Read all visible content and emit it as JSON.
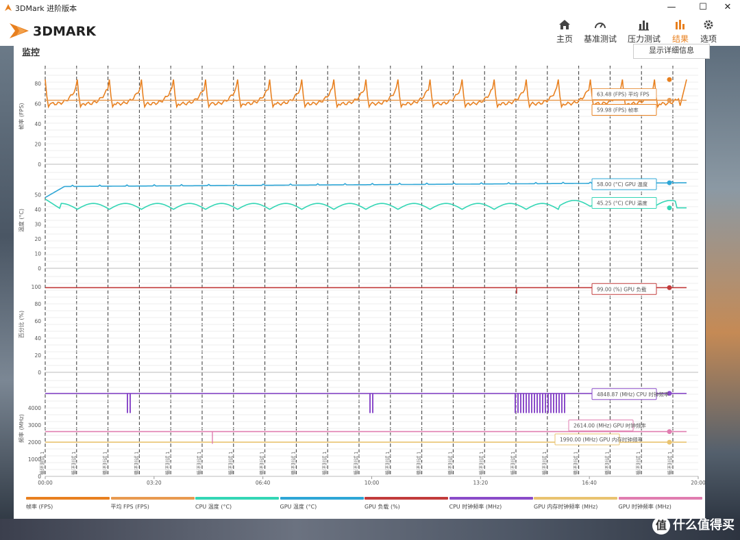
{
  "window": {
    "title": "3DMark 进阶版本",
    "minimize": "—",
    "maximize": "☐",
    "close": "✕"
  },
  "brand": {
    "logo_text": "3DMARK",
    "accent": "#e8801f"
  },
  "nav": {
    "items": [
      {
        "label": "主页",
        "icon": "home-icon"
      },
      {
        "label": "基准测试",
        "icon": "gauge-icon"
      },
      {
        "label": "压力测试",
        "icon": "bar-chart-icon"
      },
      {
        "label": "结果",
        "icon": "results-icon",
        "active": true
      },
      {
        "label": "选项",
        "icon": "gear-icon"
      }
    ]
  },
  "panel": {
    "title": "监控",
    "detail_button": "显示详细信息"
  },
  "chart_data": {
    "type": "line",
    "x_ticks": [
      "00:00",
      "03:20",
      "06:40",
      "10:00",
      "13:20",
      "16:40",
      "20:00"
    ],
    "x_range_seconds": [
      0,
      1200
    ],
    "test_marker_label": "循环测试 1",
    "subplots": [
      {
        "ylabel": "帧率 (FPS)",
        "yticks": [
          0,
          20,
          40,
          60,
          80
        ],
        "ylim": [
          0,
          95
        ],
        "series": [
          {
            "name": "帧率 (FPS)",
            "color": "#e8801f",
            "pattern": "sawtooth",
            "base": 58,
            "peak": 84,
            "end": 84
          },
          {
            "name": "平均 FPS (FPS)",
            "color": "#e89a50",
            "constant": 63.48
          }
        ],
        "callouts": [
          {
            "text": "63.48 (FPS) 平均 FPS",
            "color": "#e89a50"
          },
          {
            "text": "59.98 (FPS) 帧率",
            "color": "#e8801f"
          }
        ]
      },
      {
        "ylabel": "温度 (°C)",
        "yticks": [
          0,
          10,
          20,
          30,
          40,
          50
        ],
        "ylim": [
          0,
          65
        ],
        "series": [
          {
            "name": "GPU 温度 (°C)",
            "color": "#2ea6d6",
            "start": 48,
            "plateau": 55.5,
            "end": 58
          },
          {
            "name": "CPU 温度 (°C)",
            "color": "#33d6b5",
            "start": 47,
            "base": 40,
            "peak": 44,
            "end": 41
          }
        ],
        "callouts": [
          {
            "text": "58.00 (°C) GPU 温度",
            "color": "#2ea6d6"
          },
          {
            "text": "45.25 (°C) CPU 温度",
            "color": "#33d6b5"
          }
        ]
      },
      {
        "ylabel": "百分比 (%)",
        "yticks": [
          0,
          20,
          40,
          60,
          80,
          100
        ],
        "ylim": [
          0,
          112
        ],
        "series": [
          {
            "name": "GPU 负载 (%)",
            "color": "#c23b3b",
            "constant": 99
          }
        ],
        "callouts": [
          {
            "text": "99.00 (%) GPU 负载",
            "color": "#c23b3b"
          }
        ]
      },
      {
        "ylabel": "频率 (MHz)",
        "yticks": [
          0,
          1000,
          2000,
          3000,
          4000
        ],
        "ylim": [
          0,
          5600
        ],
        "series": [
          {
            "name": "CPU 时钟频率 (MHz)",
            "color": "#8a4bc9",
            "constant": 4848.87
          },
          {
            "name": "GPU 时钟频率 (MHz)",
            "color": "#e07db0",
            "constant": 2614
          },
          {
            "name": "GPU 内存时钟频率 (MHz)",
            "color": "#e9c370",
            "constant": 1995
          }
        ],
        "callouts": [
          {
            "text": "4848.87 (MHz) CPU 时钟频率",
            "color": "#8a4bc9"
          },
          {
            "text": "2614.00 (MHz) GPU 时钟频率",
            "color": "#e07db0"
          },
          {
            "text": "1990.00 (MHz) GPU 内存时钟频率",
            "color": "#e9c370"
          }
        ]
      }
    ]
  },
  "legend": [
    {
      "label": "帧率 (FPS)",
      "color": "#e8801f"
    },
    {
      "label": "平均 FPS (FPS)",
      "color": "#e89a50"
    },
    {
      "label": "CPU 温度 (°C)",
      "color": "#33d6b5"
    },
    {
      "label": "GPU 温度 (°C)",
      "color": "#2ea6d6"
    },
    {
      "label": "GPU 负载 (%)",
      "color": "#c23b3b"
    },
    {
      "label": "CPU 时钟频率 (MHz)",
      "color": "#8a4bc9"
    },
    {
      "label": "GPU 内存时钟频率 (MHz)",
      "color": "#e9c370"
    },
    {
      "label": "GPU 时钟频率 (MHz)",
      "color": "#e07db0"
    }
  ],
  "watermark": {
    "icon_glyph": "值",
    "text": "什么值得买"
  }
}
